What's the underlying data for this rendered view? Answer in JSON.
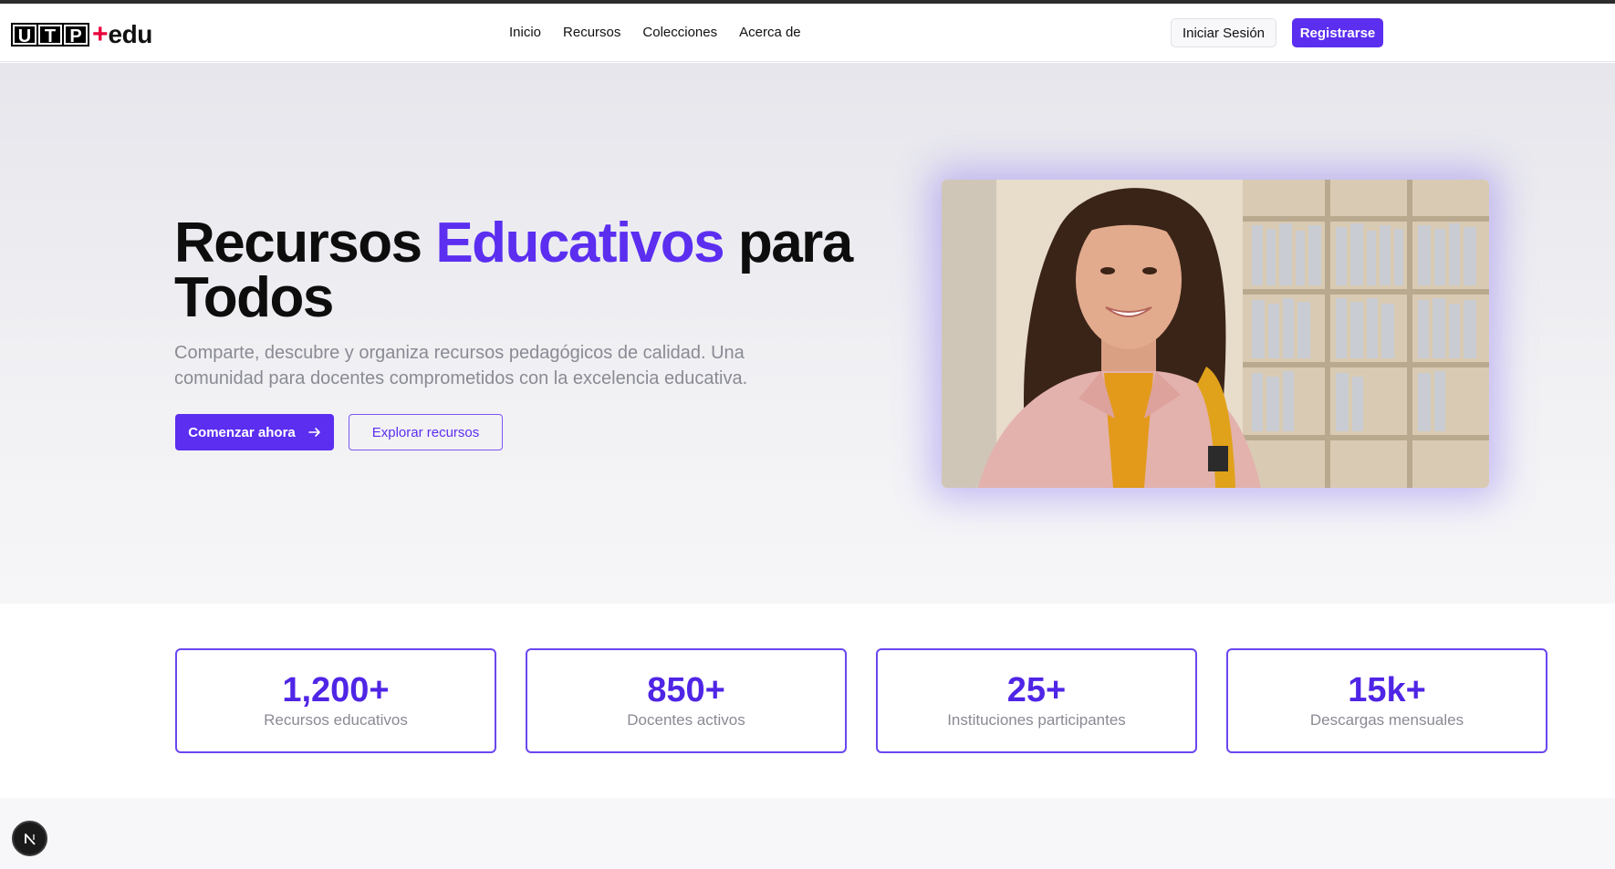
{
  "header": {
    "logo": {
      "letters": [
        "U",
        "T",
        "P"
      ],
      "plus": "+",
      "suffix": "edu"
    },
    "nav": [
      "Inicio",
      "Recursos",
      "Colecciones",
      "Acerca de"
    ],
    "login_label": "Iniciar Sesión",
    "register_label": "Registrarse"
  },
  "hero": {
    "title_part1": "Recursos ",
    "title_accent": "Educativos",
    "title_part2": " para Todos",
    "subtitle": "Comparte, descubre y organiza recursos pedagógicos de calidad. Una comunidad para docentes comprometidos con la excelencia educativa.",
    "primary_label": "Comenzar ahora",
    "secondary_label": "Explorar recursos",
    "image_subject": "smiling student with yellow backpack in library"
  },
  "stats": [
    {
      "value": "1,200+",
      "label": "Recursos educativos"
    },
    {
      "value": "850+",
      "label": "Docentes activos"
    },
    {
      "value": "25+",
      "label": "Instituciones participantes"
    },
    {
      "value": "15k+",
      "label": "Descargas mensuales"
    }
  ],
  "badge": {
    "letter": "N"
  },
  "colors": {
    "accent": "#5b2ef0",
    "stat_value": "#4f25e6",
    "muted_text": "#8a8a94",
    "logo_plus": "#e8003a"
  },
  "icons": {
    "arrow": "arrow-right-icon"
  }
}
